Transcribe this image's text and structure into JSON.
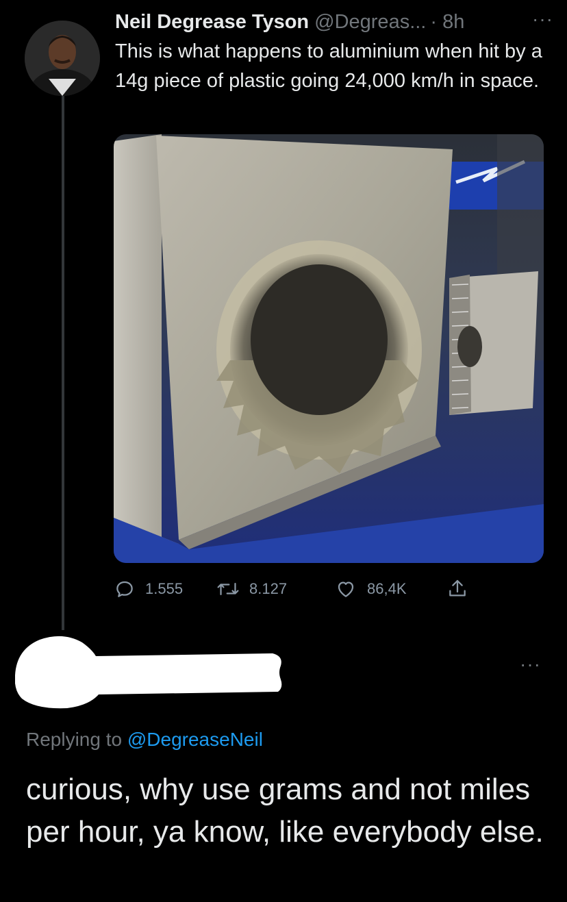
{
  "tweet": {
    "author_name": "Neil Degrease Tyson",
    "author_handle": "@Degreas...",
    "time": "· 8h",
    "more": "···",
    "text": "This is what happens to aluminium when hit by a 14g piece of plastic going 24,000 km/h in space.",
    "actions": {
      "reply_count": "1.555",
      "retweet_count": "8.127",
      "like_count": "86,4K"
    }
  },
  "reply": {
    "more": "···",
    "replying_prefix": "Replying to ",
    "replying_handle": "@DegreaseNeil",
    "text": "curious, why use grams and not miles per hour, ya know, like everybody else."
  },
  "colors": {
    "background": "#000000",
    "text": "#e7e9ea",
    "muted": "#71767b",
    "link": "#1d9bf0",
    "thread_line": "#333639"
  }
}
